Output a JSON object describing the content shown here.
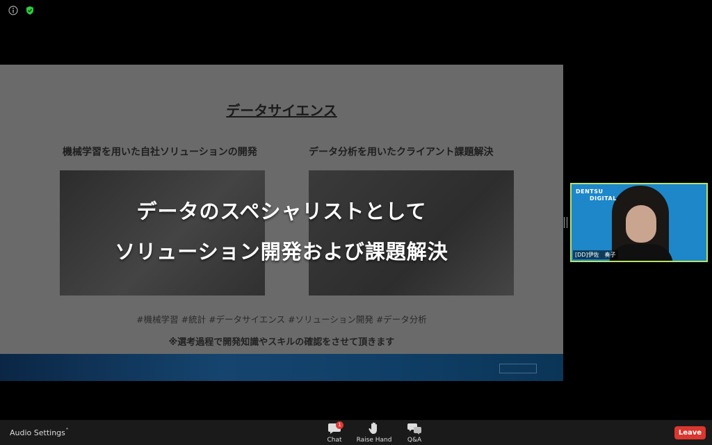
{
  "slide": {
    "title": "データサイエンス",
    "left_heading": "機械学習を用いた自社ソリューションの開発",
    "right_heading": "データ分析を用いたクライアント課題解決",
    "overlay_line1": "データのスペシャリストとして",
    "overlay_line2": "ソリューション開発および課題解決",
    "tags": "#機械学習 #統計 #データサイエンス #ソリューション開発 #データ分析",
    "note": "※選考過程で開発知識やスキルの確認をさせて頂きます"
  },
  "participant": {
    "name": "[DD]伊佐　奏子",
    "brand_line1": "DENTSU",
    "brand_line2": "DIGITAL"
  },
  "toolbar": {
    "audio_settings": "Audio Settings",
    "chat_label": "Chat",
    "chat_badge": "1",
    "raise_hand_label": "Raise Hand",
    "qa_label": "Q&A",
    "leave_label": "Leave"
  },
  "colors": {
    "leave": "#d9372f",
    "badge": "#e23a35",
    "active_speaker_border": "#b9e26a",
    "shield": "#2ecc40"
  }
}
